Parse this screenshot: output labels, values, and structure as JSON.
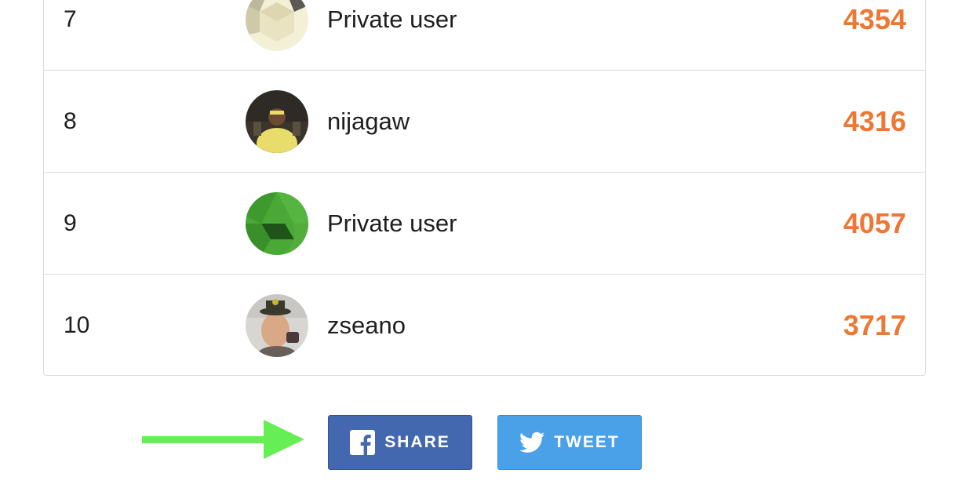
{
  "leaderboard": {
    "rows": [
      {
        "rank": "7",
        "username": "Private user",
        "score": "4354",
        "avatar": "hexagon-pale-icon"
      },
      {
        "rank": "8",
        "username": "nijagaw",
        "score": "4316",
        "avatar": "user-photo"
      },
      {
        "rank": "9",
        "username": "Private user",
        "score": "4057",
        "avatar": "hexagon-green-icon"
      },
      {
        "rank": "10",
        "username": "zseano",
        "score": "3717",
        "avatar": "user-photo"
      }
    ]
  },
  "share": {
    "facebook_label": "SHARE",
    "twitter_label": "TWEET"
  },
  "colors": {
    "score": "#ee7733",
    "facebook": "#4468b0",
    "twitter": "#4aa1e8",
    "arrow": "#66ee55"
  }
}
